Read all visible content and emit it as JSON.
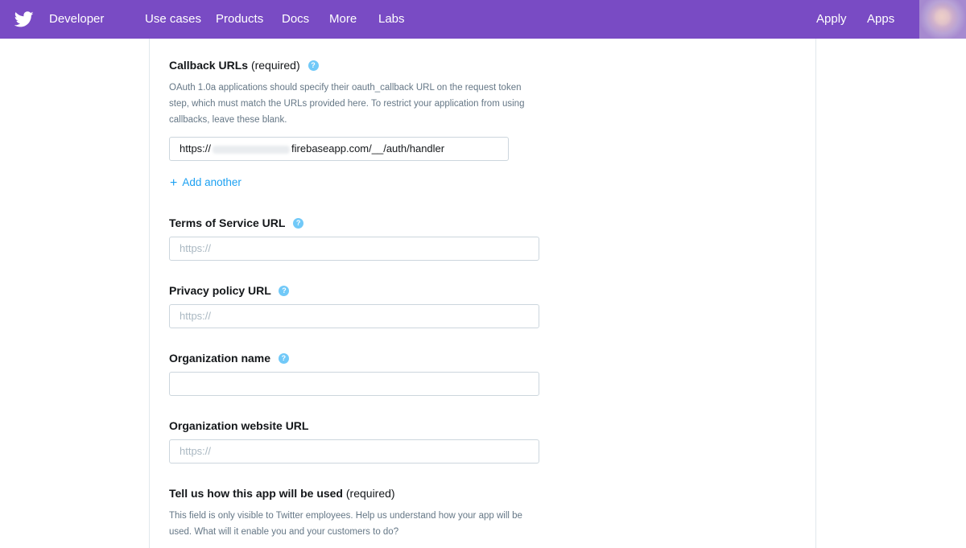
{
  "nav": {
    "brand": "Developer",
    "links": [
      "Use cases",
      "Products",
      "Docs",
      "More",
      "Labs"
    ],
    "right_links": [
      "Apply",
      "Apps"
    ]
  },
  "callback": {
    "label": "Callback URLs",
    "required": "(required)",
    "help": "?",
    "description": "OAuth 1.0a applications should specify their oauth_callback URL on the request token step, which must match the URLs provided here. To restrict your application from using callbacks, leave these blank.",
    "value_prefix": "https://",
    "value_suffix": "firebaseapp.com/__/auth/handler",
    "add_another": "Add another"
  },
  "tos": {
    "label": "Terms of Service URL",
    "help": "?",
    "placeholder": "https://"
  },
  "privacy": {
    "label": "Privacy policy URL",
    "help": "?",
    "placeholder": "https://"
  },
  "org_name": {
    "label": "Organization name",
    "help": "?",
    "placeholder": ""
  },
  "org_site": {
    "label": "Organization website URL",
    "placeholder": "https://"
  },
  "usage": {
    "label": "Tell us how this app will be used",
    "required": "(required)",
    "description": "This field is only visible to Twitter employees. Help us understand how your app will be used. What will it enable you and your customers to do?"
  },
  "colors": {
    "nav_bg": "#794bc4",
    "link": "#1da1f2",
    "help_icon": "#71c9f8"
  }
}
